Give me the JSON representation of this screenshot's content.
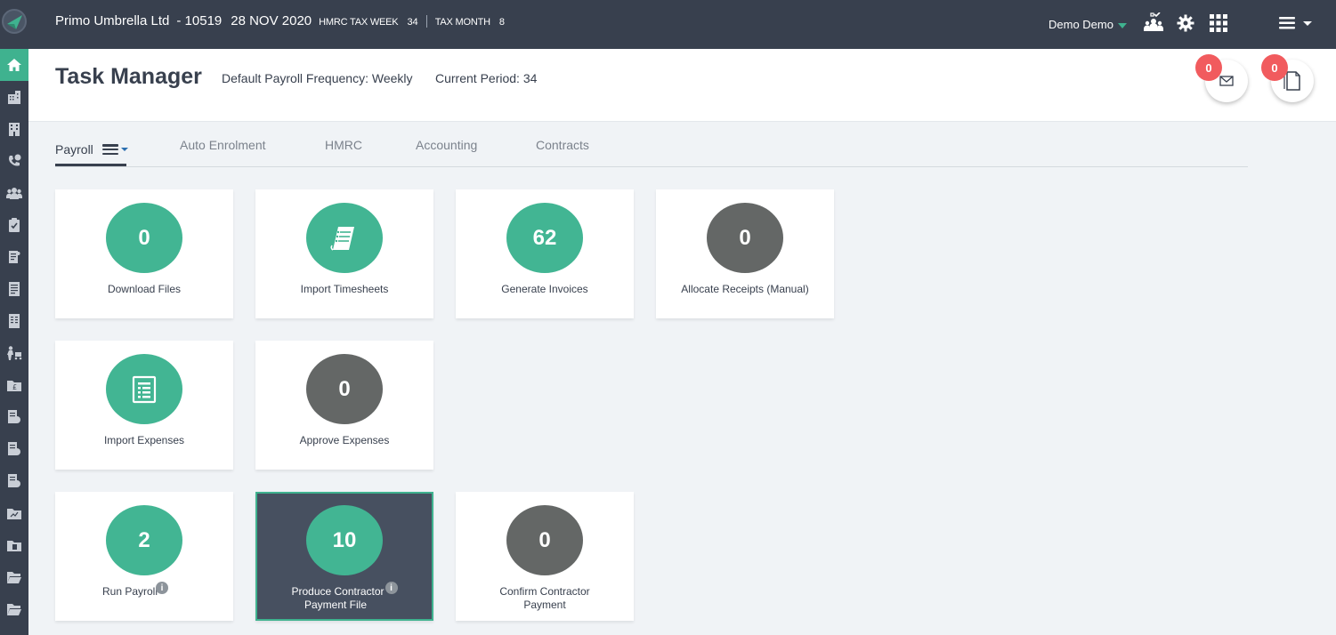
{
  "topbar": {
    "company": "Primo Umbrella Ltd",
    "code": "- 10519",
    "date": "28 NOV 2020",
    "tax_week_label": "HMRC TAX WEEK",
    "tax_week_value": "34",
    "tax_month_label": "TAX MONTH",
    "tax_month_value": "8",
    "user": "Demo Demo"
  },
  "header": {
    "title": "Task Manager",
    "frequency": "Default Payroll Frequency: Weekly",
    "period": "Current Period: 34",
    "messages_count": "0",
    "documents_count": "0"
  },
  "tabs": [
    "Payroll",
    "Auto Enrolment",
    "HMRC",
    "Accounting",
    "Contracts"
  ],
  "cards": [
    {
      "value": "0",
      "label": "Download Files",
      "color": "green"
    },
    {
      "value": "",
      "label": "Import Timesheets",
      "color": "green",
      "icon": "timesheet-icon"
    },
    {
      "value": "62",
      "label": "Generate Invoices",
      "color": "green"
    },
    {
      "value": "0",
      "label": "Allocate Receipts (Manual)",
      "color": "grey"
    },
    {
      "value": "",
      "label": "Import Expenses",
      "color": "green",
      "icon": "expenses-document-icon"
    },
    {
      "value": "0",
      "label": "Approve Expenses",
      "color": "grey"
    },
    {
      "value": "2",
      "label": "Run Payroll",
      "color": "green"
    },
    {
      "value": "10",
      "label_line1": "Produce Contractor",
      "label_line2": "Payment File",
      "color": "green",
      "selected": true
    },
    {
      "value": "0",
      "label_line1": "Confirm Contractor",
      "label_line2": "Payment",
      "color": "grey"
    }
  ],
  "colors": {
    "topbar": "#38404e",
    "accent_green": "#42b593",
    "grey_circle": "#646766",
    "badge_red": "#f15b5e",
    "selected_card": "#475060"
  }
}
